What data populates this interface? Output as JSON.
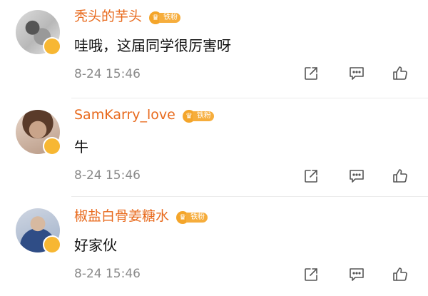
{
  "comments": [
    {
      "username": "秃头的芋头",
      "fan_badge": "铁粉",
      "fan_icon": "crown-glyph",
      "text": "哇哦，这届同学很厉害呀",
      "time": "8-24 15:46"
    },
    {
      "username": "SamKarry_love",
      "fan_badge": "铁粉",
      "fan_icon": "crown-glyph",
      "text": "牛",
      "time": "8-24 15:46"
    },
    {
      "username": "椒盐白骨姜糖水",
      "fan_badge": "铁粉",
      "fan_icon": "crown-glyph",
      "text": "好家伙",
      "time": "8-24 15:46"
    }
  ],
  "colors": {
    "username": "#e86a1d",
    "badge": "#f6ad3c",
    "time": "#8a8a8a",
    "icon": "#555555",
    "verified": "#f7b733"
  },
  "icons": {
    "share": "share-icon",
    "comment": "comment-icon",
    "like": "like-icon"
  }
}
